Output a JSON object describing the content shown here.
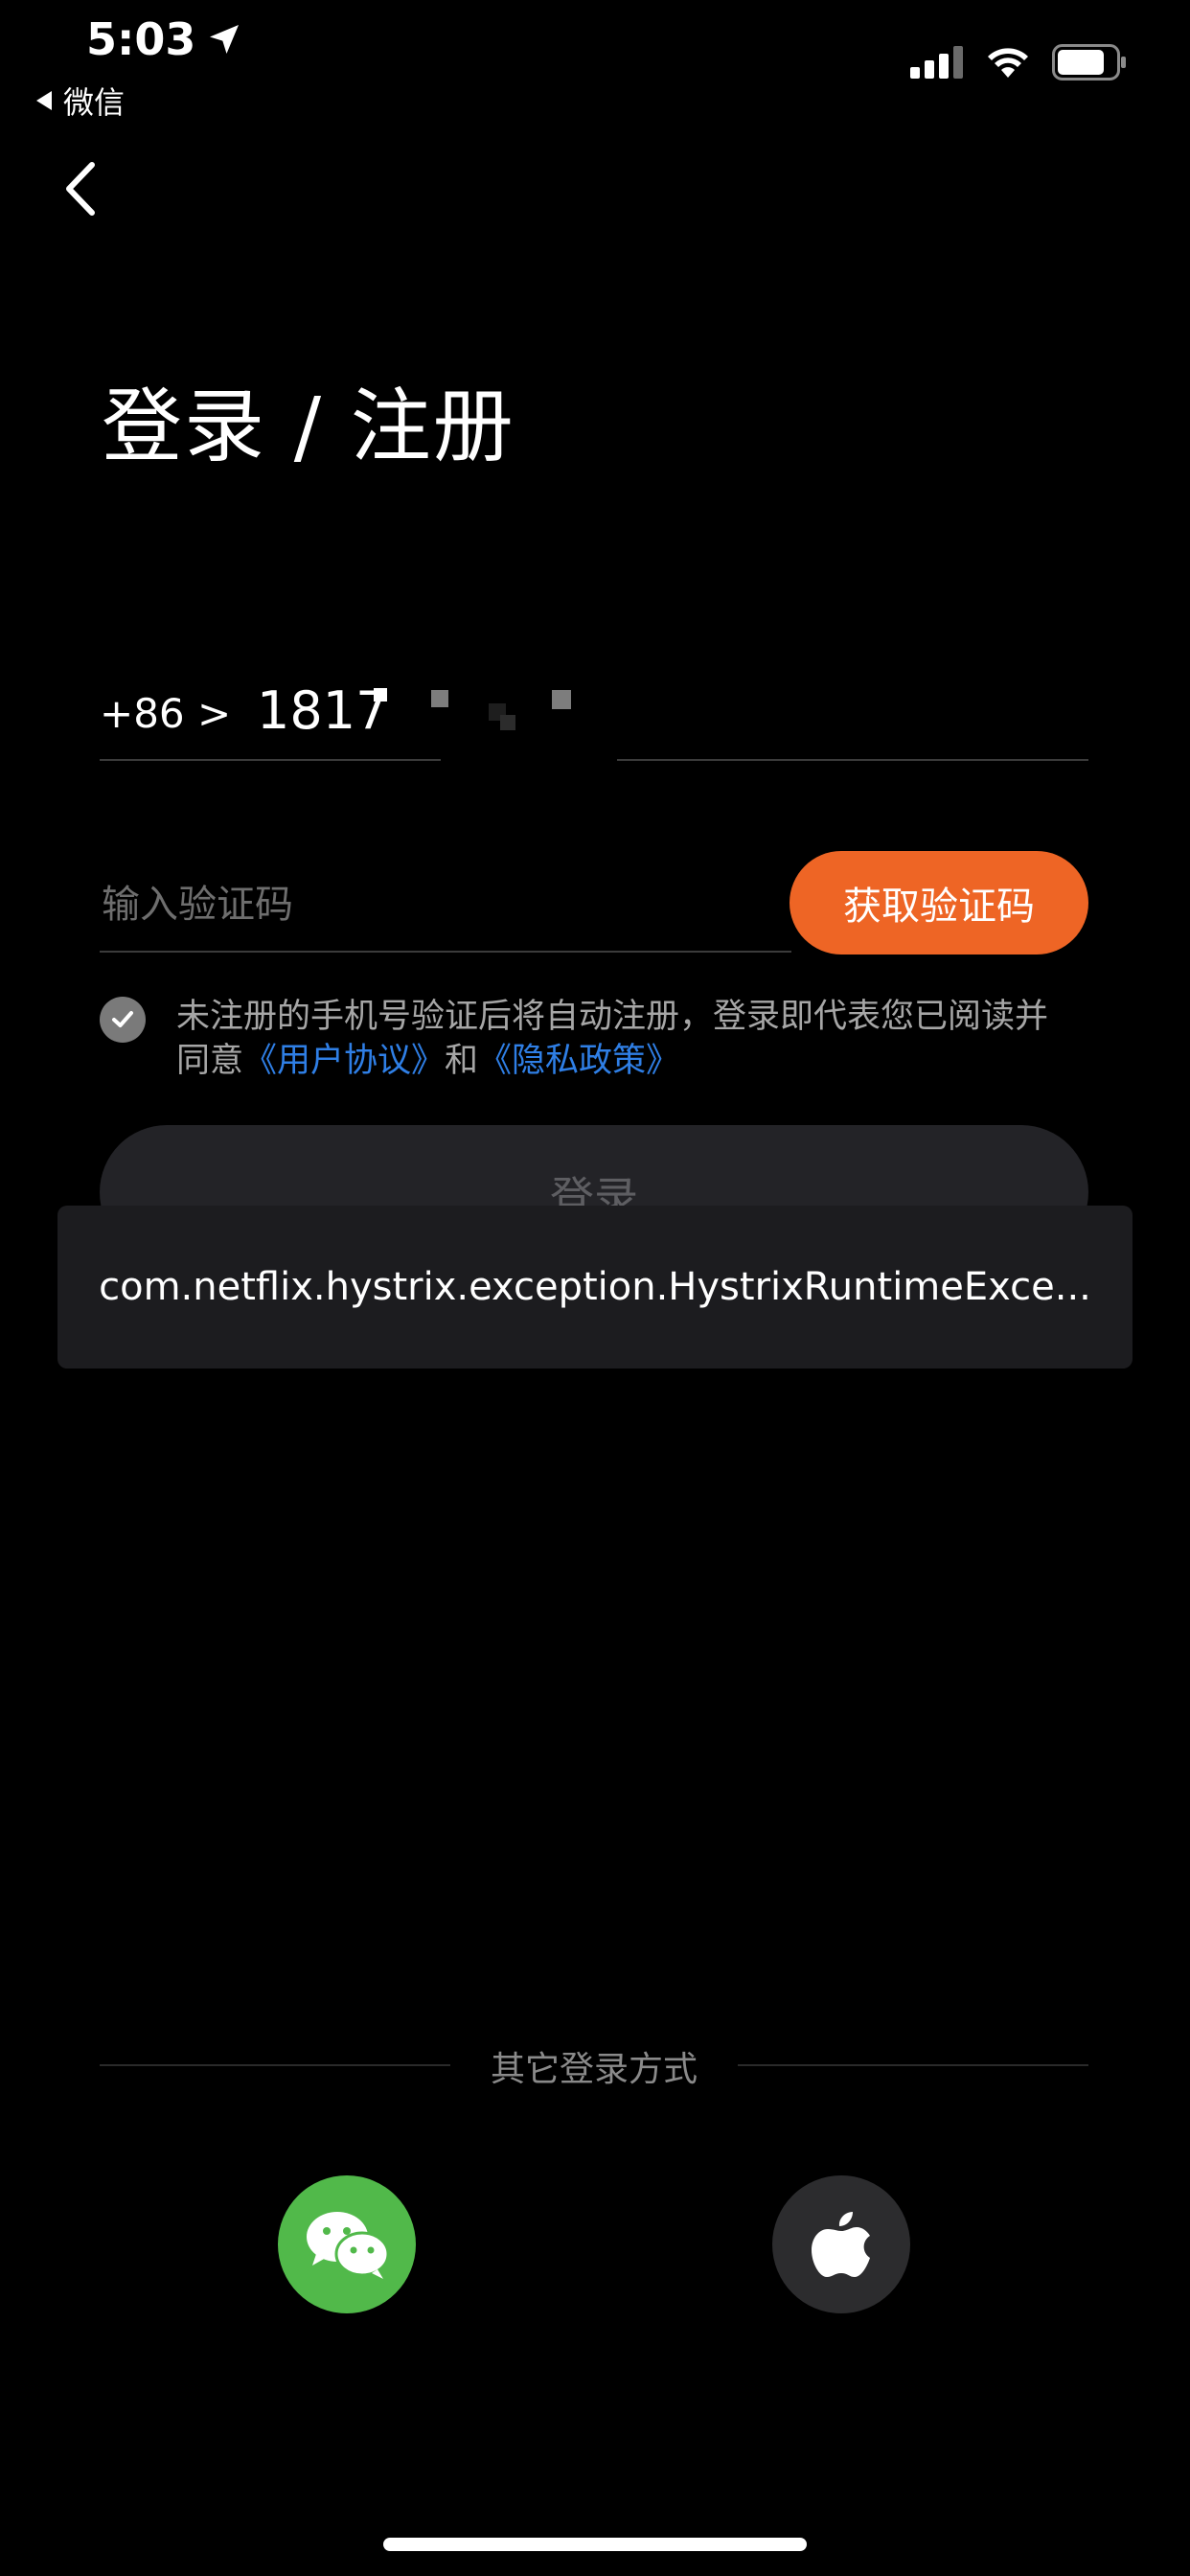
{
  "status_bar": {
    "time": "5:03",
    "back_app": "微信"
  },
  "header": {
    "title": "登录 / 注册"
  },
  "phone": {
    "country_code": "+86 >",
    "value": "1817"
  },
  "code": {
    "placeholder": "输入验证码",
    "get_code_label": "获取验证码"
  },
  "agreement": {
    "text": "未注册的手机号验证后将自动注册，登录即代表您已阅读并同意",
    "user_agreement": "《用户协议》",
    "and": "和",
    "privacy_policy": "《隐私政策》",
    "checked": true
  },
  "login_button": {
    "label": "登录"
  },
  "toast": {
    "message": "com.netflix.hystrix.exception.HystrixRuntimeExce..."
  },
  "other_login": {
    "label": "其它登录方式",
    "methods": [
      "wechat-icon",
      "apple-icon"
    ]
  },
  "colors": {
    "accent": "#ee6525",
    "link": "#2f7fe6",
    "wechat": "#51b94a",
    "background": "#000000"
  }
}
